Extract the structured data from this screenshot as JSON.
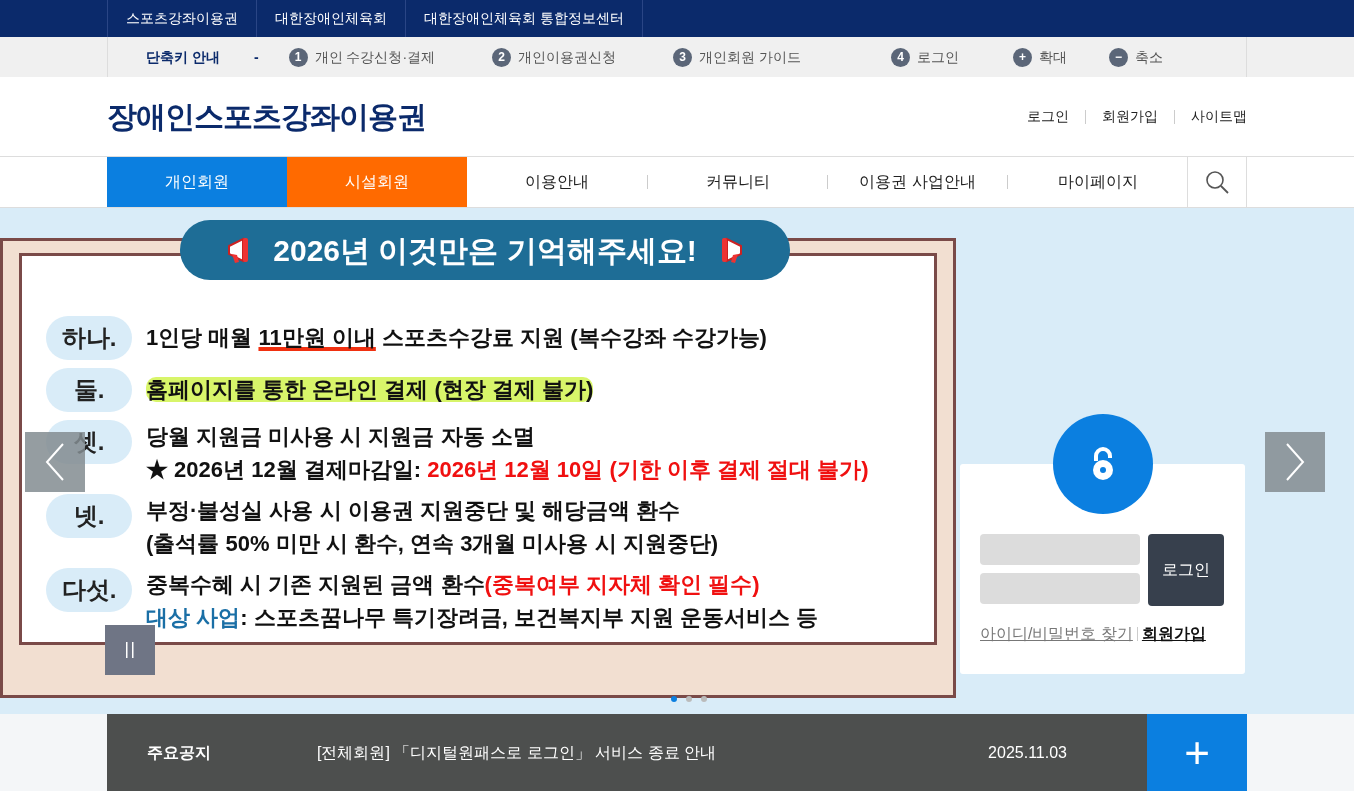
{
  "top_links": [
    "스포츠강좌이용권",
    "대한장애인체육회",
    "대한장애인체육회 통합정보센터"
  ],
  "shortcuts": {
    "title": "단축키 안내",
    "separator": "-",
    "items": [
      {
        "key": "1",
        "label": "개인 수강신청·결제"
      },
      {
        "key": "2",
        "label": "개인이용권신청"
      },
      {
        "key": "3",
        "label": "개인회원 가이드"
      },
      {
        "key": "4",
        "label": "로그인"
      },
      {
        "key": "+",
        "label": "확대"
      },
      {
        "key": "−",
        "label": "축소"
      }
    ]
  },
  "logo": "장애인스포츠강좌이용권",
  "header_links": [
    "로그인",
    "회원가입",
    "사이트맵"
  ],
  "nav": [
    {
      "label": "개인회원",
      "kind": "primary"
    },
    {
      "label": "시설회원",
      "kind": "accent"
    },
    {
      "label": "이용안내",
      "kind": "plain"
    },
    {
      "label": "커뮤니티",
      "kind": "plain"
    },
    {
      "label": "이용권 사업안내",
      "kind": "plain"
    },
    {
      "label": "마이페이지",
      "kind": "plain"
    }
  ],
  "banner": {
    "title": "2026년 이것만은 기억해주세요!",
    "rows": [
      {
        "label": "하나.",
        "lines": [
          [
            {
              "text": "1인당 매월 ",
              "kind": "plain"
            },
            {
              "text": "11만원 이내",
              "kind": "underline"
            },
            {
              "text": " 스포츠수강료 지원 (복수강좌 수강가능)",
              "kind": "plain"
            }
          ]
        ]
      },
      {
        "label": "둘.",
        "lines": [
          [
            {
              "text": "홈페이지를 통한 온라인 결제 (현장 결제 불가)",
              "kind": "highlight"
            }
          ]
        ]
      },
      {
        "label": "셋.",
        "lines": [
          [
            {
              "text": "당월 지원금 미사용 시 지원금 자동 소멸",
              "kind": "plain"
            }
          ],
          [
            {
              "text": "★ 2026년 12월 결제마감일: ",
              "kind": "plain"
            },
            {
              "text": "2026년 12월 10일 (기한 이후 결제 절대 불가)",
              "kind": "red"
            }
          ]
        ]
      },
      {
        "label": "넷.",
        "lines": [
          [
            {
              "text": "부정·불성실 사용 시 이용권 지원중단 및 해당금액 환수",
              "kind": "plain"
            }
          ],
          [
            {
              "text": "(출석률 50% 미만 시 환수, 연속 3개월 미사용 시 지원중단)",
              "kind": "plain"
            }
          ]
        ]
      },
      {
        "label": "다섯.",
        "lines": [
          [
            {
              "text": "중복수혜 시 기존 지원된 금액 환수",
              "kind": "plain"
            },
            {
              "text": "(중복여부 지자체 확인 필수)",
              "kind": "red"
            }
          ],
          [
            {
              "text": "대상 사업",
              "kind": "blue"
            },
            {
              "text": ": 스포츠꿈나무 특기장려금, 보건복지부 지원 운동서비스 등",
              "kind": "plain"
            }
          ]
        ]
      }
    ]
  },
  "carousel": {
    "dots": [
      {
        "selected": true
      },
      {
        "selected": false
      },
      {
        "selected": false
      }
    ]
  },
  "login": {
    "button": "로그인",
    "find": "아이디/비밀번호 찾기",
    "join": "회원가입"
  },
  "notice": {
    "title": "주요공지",
    "text": "[전체회원] 「디지털원패스로 로그인」 서비스 종료 안내",
    "date": "2025.11.03",
    "more": "+"
  }
}
